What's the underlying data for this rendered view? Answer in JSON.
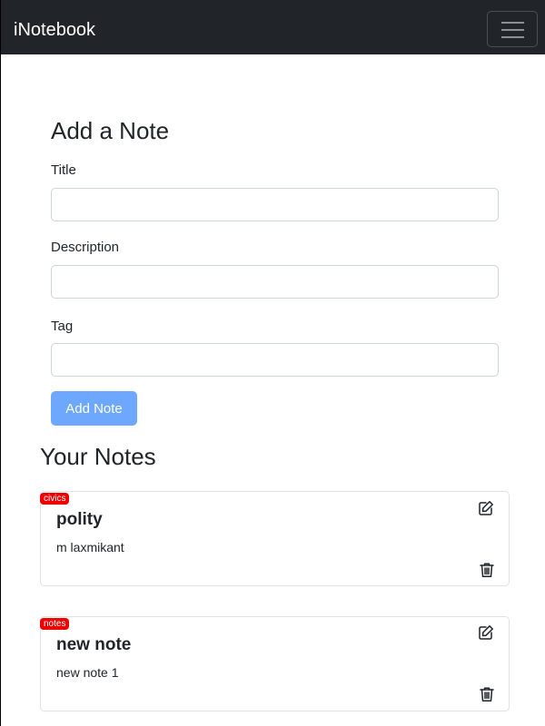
{
  "navbar": {
    "brand": "iNotebook",
    "toggler_icon": "hamburger-icon"
  },
  "form": {
    "heading": "Add a Note",
    "title_label": "Title",
    "title_value": "",
    "description_label": "Description",
    "description_value": "",
    "tag_label": "Tag",
    "tag_value": "",
    "submit_label": "Add Note"
  },
  "notes": {
    "heading": "Your Notes",
    "items": [
      {
        "tag": "civics",
        "title": "polity",
        "description": "m laxmikant",
        "edit_icon": "edit-icon",
        "delete_icon": "trash-icon"
      },
      {
        "tag": "notes",
        "title": "new note",
        "description": "new note 1",
        "edit_icon": "edit-icon",
        "delete_icon": "trash-icon"
      }
    ]
  },
  "colors": {
    "navbar_bg": "#212529",
    "button_bg": "#6ea8fe",
    "badge_bg": "#ee0000"
  }
}
